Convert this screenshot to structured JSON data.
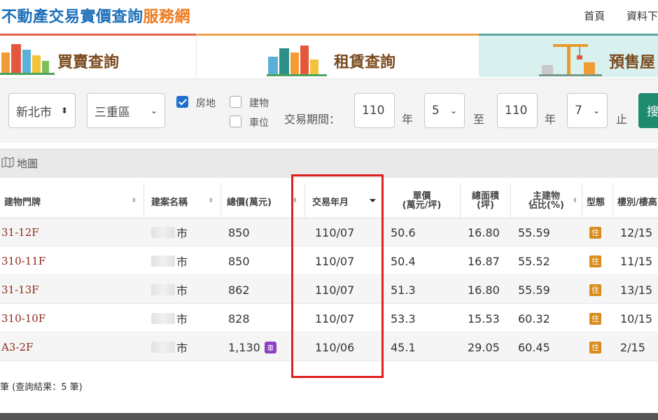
{
  "header": {
    "title_blue": "不動產交易實價查詢",
    "title_orange": "服務網",
    "nav": [
      "首頁",
      "資料下"
    ]
  },
  "tabs": [
    {
      "label": "買賣查詢"
    },
    {
      "label": "租賃查詢"
    },
    {
      "label": "預售屋"
    }
  ],
  "filter": {
    "city": "新北市",
    "district": "三重區",
    "checkboxes": [
      {
        "label": "房地",
        "checked": true
      },
      {
        "label": "建物",
        "checked": false
      },
      {
        "label": "車位",
        "checked": false
      }
    ],
    "period_label": "交易期間：",
    "start_year": "110",
    "year_unit": "年",
    "start_month": "5",
    "to": "至",
    "end_year": "110",
    "end_month": "7",
    "end": "止",
    "search_btn": "搜"
  },
  "map_toggle": "地圖",
  "table": {
    "headers": [
      "建物門牌",
      "建案名稱",
      "總價(萬元)",
      "交易年月",
      "單價\n(萬元/坪)",
      "總面積\n(坪)",
      "主建物\n佔比(%)",
      "型態",
      "樓別/樓高"
    ],
    "rows": [
      {
        "address": "31-12F",
        "project": "市",
        "price": "850",
        "date": "110/07",
        "unit": "50.6",
        "area": "16.80",
        "ratio": "55.59",
        "type": "住",
        "floor": "12/15",
        "parking": false
      },
      {
        "address": "310-11F",
        "project": "市",
        "price": "850",
        "date": "110/07",
        "unit": "50.4",
        "area": "16.87",
        "ratio": "55.52",
        "type": "住",
        "floor": "11/15",
        "parking": false
      },
      {
        "address": "31-13F",
        "project": "市",
        "price": "862",
        "date": "110/07",
        "unit": "51.3",
        "area": "16.80",
        "ratio": "55.59",
        "type": "住",
        "floor": "13/15",
        "parking": false
      },
      {
        "address": "310-10F",
        "project": "市",
        "price": "828",
        "date": "110/07",
        "unit": "53.3",
        "area": "15.53",
        "ratio": "60.32",
        "type": "住",
        "floor": "10/15",
        "parking": false
      },
      {
        "address": "A3-2F",
        "project": "市",
        "price": "1,130",
        "date": "110/06",
        "unit": "45.1",
        "area": "29.05",
        "ratio": "60.45",
        "type": "住",
        "floor": "2/15",
        "parking": true
      }
    ],
    "parking_badge": "車"
  },
  "footer_note": "筆 (查詢結果：5 筆)",
  "colors": {
    "brand_blue": "#1c6fb8",
    "brand_orange": "#ee7a1b",
    "highlight": "#e02020",
    "search_button": "#1e8a6e"
  }
}
